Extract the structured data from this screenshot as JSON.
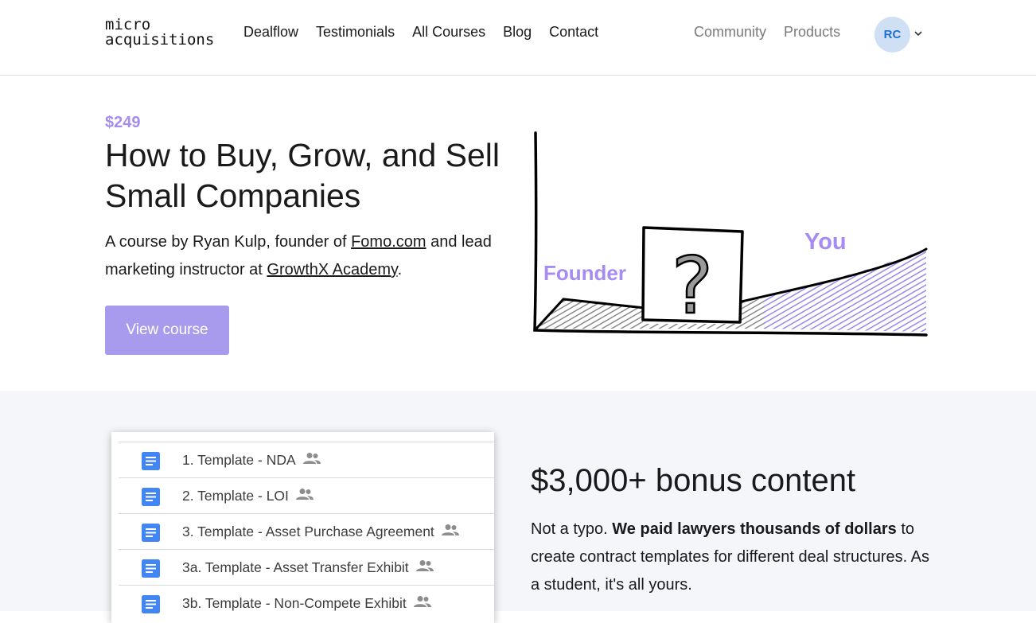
{
  "header": {
    "logo_line1": "micro",
    "logo_line2": "acquisitions",
    "nav_main": [
      "Dealflow",
      "Testimonials",
      "All Courses",
      "Blog",
      "Contact"
    ],
    "nav_secondary": [
      "Community",
      "Products"
    ],
    "avatar_initials": "RC"
  },
  "hero": {
    "price": "$249",
    "title": "How to Buy, Grow, and Sell Small Companies",
    "desc_part1": "A course by Ryan Kulp, founder of ",
    "desc_link1": "Fomo.com",
    "desc_part2": " and lead marketing instructor at ",
    "desc_link2": "GrowthX Academy",
    "desc_part3": ".",
    "button_label": "View course",
    "illustration": {
      "label_founder": "Founder",
      "label_you": "You",
      "question_mark": "?"
    }
  },
  "bonus": {
    "title": "$3,000+ bonus content",
    "desc_part1": "Not a typo. ",
    "desc_bold": "We paid lawyers thousands of dollars",
    "desc_part2": " to create contract templates for different deal structures. As a student, it's all yours.",
    "documents": [
      "1. Template - NDA",
      "2. Template - LOI",
      "3. Template - Asset Purchase Agreement",
      "3a. Template - Asset Transfer Exhibit",
      "3b. Template - Non-Compete Exhibit"
    ]
  },
  "colors": {
    "accent": "#a68cf0",
    "button": "#a89bee",
    "avatar_bg": "#cfe0f5",
    "avatar_text": "#1f6fd1",
    "doc_blue": "#4285f4",
    "section_bg": "#f5f6fa"
  },
  "icons": [
    "chevron-down-icon",
    "document-icon",
    "shared-people-icon"
  ]
}
